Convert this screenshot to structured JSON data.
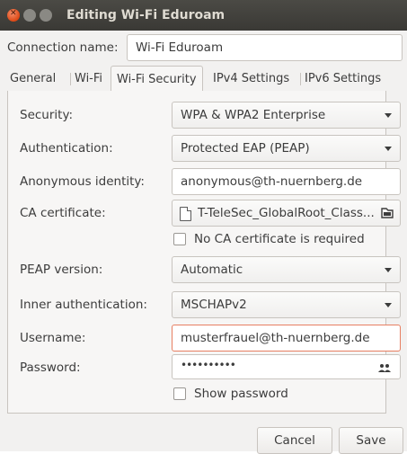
{
  "window": {
    "title": "Editing Wi-Fi Eduroam"
  },
  "connection": {
    "label": "Connection name:",
    "value": "Wi-Fi Eduroam"
  },
  "tabs": [
    {
      "label": "General"
    },
    {
      "label": "Wi-Fi"
    },
    {
      "label": "Wi-Fi Security"
    },
    {
      "label": "IPv4 Settings"
    },
    {
      "label": "IPv6 Settings"
    }
  ],
  "active_tab": "Wi-Fi Security",
  "security": {
    "security_label": "Security:",
    "security_value": "WPA & WPA2 Enterprise",
    "auth_label": "Authentication:",
    "auth_value": "Protected EAP (PEAP)",
    "anon_label": "Anonymous identity:",
    "anon_value": "anonymous@th-nuernberg.de",
    "ca_label": "CA certificate:",
    "ca_value": "T-TeleSec_GlobalRoot_Class...",
    "no_ca_label": "No CA certificate is required",
    "peap_label": "PEAP version:",
    "peap_value": "Automatic",
    "inner_label": "Inner authentication:",
    "inner_value": "MSCHAPv2",
    "username_label": "Username:",
    "username_value": "musterfrauel@th-nuernberg.de",
    "password_label": "Password:",
    "password_value": "••••••••••",
    "show_password_label": "Show password"
  },
  "buttons": {
    "cancel": "Cancel",
    "save": "Save"
  },
  "colors": {
    "titlebar": "#3c3b37",
    "close_button": "#dd4814",
    "focus_border": "#e77f62",
    "window_bg": "#f2f1f0"
  }
}
